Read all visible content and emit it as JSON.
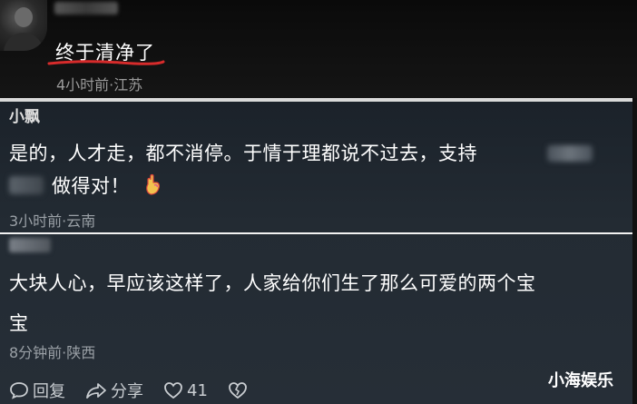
{
  "top_comment": {
    "text": "终于清净了",
    "meta": "4小时前·江苏"
  },
  "comment1": {
    "author": "小飘",
    "line1": "是的，人才走，都不消停。于情于理都说不过去，支持",
    "line2": "做得对！",
    "meta": "3小时前·云南"
  },
  "comment2": {
    "line1": "大块人心，早应该这样了，人家给你们生了那么可爱的两个宝",
    "line2": "宝",
    "meta": "8分钟前·陕西"
  },
  "actions": {
    "reply_label": "回复",
    "share_label": "分享",
    "like_count": "41"
  },
  "watermark": "小海娱乐",
  "colors": {
    "underline": "#d62b2b",
    "panel_bg": "#222a32",
    "meta_text": "#9aa0a6"
  },
  "icons": [
    "comment-icon",
    "share-icon",
    "heart-icon",
    "broken-heart-icon",
    "hand-emoji-icon"
  ]
}
